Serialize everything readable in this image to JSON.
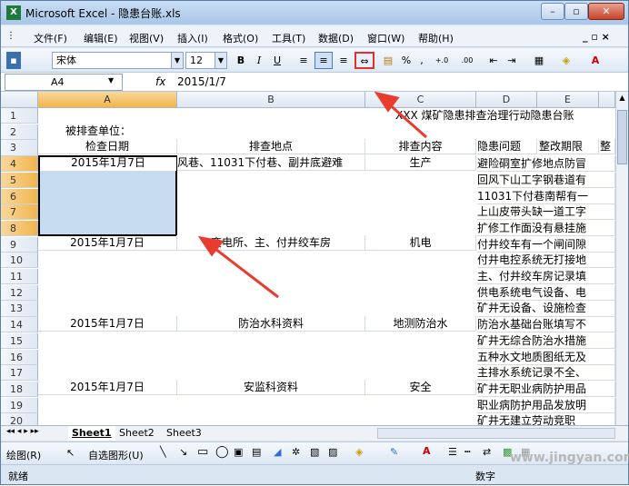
{
  "window": {
    "title": "Microsoft Excel - 隐患台账.xls",
    "app_icon": "excel-icon",
    "minimize": "–",
    "maximize": "▫",
    "close": "✕"
  },
  "menu": [
    {
      "label": "文件(F)"
    },
    {
      "label": "编辑(E)"
    },
    {
      "label": "视图(V)"
    },
    {
      "label": "插入(I)"
    },
    {
      "label": "格式(O)"
    },
    {
      "label": "工具(T)"
    },
    {
      "label": "数据(D)"
    },
    {
      "label": "窗口(W)"
    },
    {
      "label": "帮助(H)"
    }
  ],
  "menu_right": "_ ▫ ×",
  "toolbar": {
    "font": "宋体",
    "size": "12",
    "bold": "B",
    "italic": "I",
    "underline": "U",
    "percent": "%",
    "comma": ",",
    "inc_dec": "+.0 .00",
    "dec_dec": ".00 +.0",
    "merge_icon": "merge-center-icon"
  },
  "formula": {
    "name_box": "A4",
    "fx": "fx",
    "value": "2015/1/7"
  },
  "columns": [
    "A",
    "B",
    "C",
    "D",
    "E"
  ],
  "rows": [
    "1",
    "2",
    "3",
    "4",
    "5",
    "6",
    "7",
    "8",
    "9",
    "10",
    "11",
    "12",
    "13",
    "14",
    "15",
    "16",
    "17",
    "18",
    "19",
    "20"
  ],
  "cells": {
    "r1c": "XXX 煤矿隐患排查治理行动隐患台账",
    "r2a": "被排查单位：",
    "r3a": "检查日期",
    "r3b": "排查地点",
    "r3c": "排查内容",
    "r3d": "隐患问题",
    "r3e": "整改期限",
    "r3f": "整",
    "r4a": "2015年1月7日",
    "r4b": "风巷、11031下付巷、副井底避难",
    "r4c": "生产",
    "r4d": "避险硐室扩修地点防冒",
    "r5d": "回风下山工字钢巷道有",
    "r6d": "11031下付巷南帮有一",
    "r7d": "上山皮带头缺一道工字",
    "r8d": "扩修工作面没有悬挂施",
    "r9a": "2015年1月7日",
    "r9b": "变电所、主、付井绞车房",
    "r9c": "机电",
    "r9d": "付井绞车有一个闸间隙",
    "r10d": "付井电控系统无打接地",
    "r11d": "主、付井绞车房记录填",
    "r12d": "供电系统电气设备、电",
    "r13d": "矿井无设备、设施检查",
    "r14a": "2015年1月7日",
    "r14b": "防治水科资料",
    "r14c": "地测防治水",
    "r14d": "防治水基础台账填写不",
    "r15d": "矿井无综合防治水措施",
    "r16d": "五种水文地质图纸无及",
    "r17d": "主排水系统记录不全、",
    "r18a": "2015年1月7日",
    "r18b": "安监科资料",
    "r18c": "安全",
    "r18d": "矿井无职业病防护用品",
    "r19d": "职业病防护用品发放明",
    "r20d": "矿井无建立劳动竞职"
  },
  "sheets": [
    "Sheet1",
    "Sheet2",
    "Sheet3"
  ],
  "draw": {
    "draw_label": "绘图(R)",
    "autoshape": "自选图形(U)"
  },
  "status": {
    "left": "就绪",
    "right": "数字"
  },
  "watermark": "www.jingyan.com"
}
